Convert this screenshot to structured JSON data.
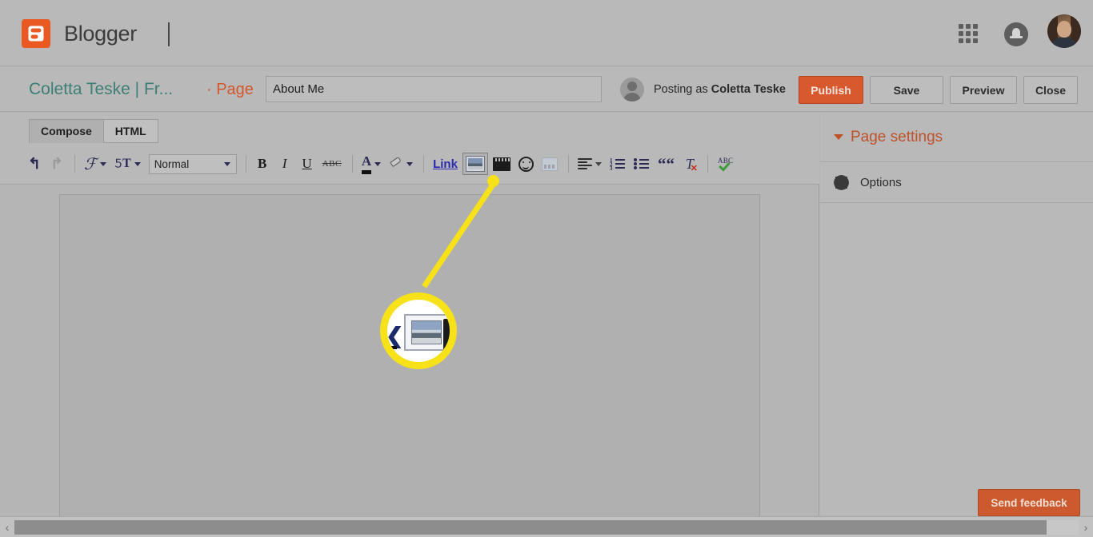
{
  "topbar": {
    "brand_name": "Blogger",
    "brand_logo_icon": "blogger-logo-icon",
    "apps_icon": "apps-grid-icon",
    "notifications_icon": "bell-icon",
    "avatar_icon": "user-avatar"
  },
  "titlerow": {
    "blog_name": "Coletta Teske  |  Fr...",
    "page_label": "· Page",
    "title_value": "About Me",
    "title_placeholder": "Page title",
    "posting_as_prefix": "Posting as ",
    "posting_as_user": "Coletta Teske",
    "buttons": {
      "publish": "Publish",
      "save": "Save",
      "preview": "Preview",
      "close": "Close"
    }
  },
  "editor": {
    "tabs": [
      {
        "label": "Compose",
        "active": true
      },
      {
        "label": "HTML",
        "active": false
      }
    ],
    "format_select_value": "Normal",
    "toolbar": [
      {
        "name": "undo-icon",
        "glyph": "↶",
        "label": "Undo"
      },
      {
        "name": "redo-icon",
        "glyph": "↷",
        "label": "Redo"
      },
      {
        "name": "font-family-icon",
        "glyph": "ℱ",
        "label": "Font"
      },
      {
        "name": "font-size-icon",
        "glyph": "TT",
        "label": "Font size"
      },
      {
        "name": "bold-icon",
        "glyph": "B",
        "label": "Bold"
      },
      {
        "name": "italic-icon",
        "glyph": "I",
        "label": "Italic"
      },
      {
        "name": "underline-icon",
        "glyph": "U",
        "label": "Underline"
      },
      {
        "name": "strikethrough-icon",
        "glyph": "ABC",
        "label": "Strikethrough"
      },
      {
        "name": "text-color-icon",
        "glyph": "A",
        "label": "Text color"
      },
      {
        "name": "highlight-icon",
        "glyph": "pen",
        "label": "Text background color"
      },
      {
        "name": "link-button",
        "glyph": "Link",
        "label": "Link"
      },
      {
        "name": "insert-image-icon",
        "glyph": "image",
        "label": "Insert image"
      },
      {
        "name": "insert-video-icon",
        "glyph": "film",
        "label": "Insert video"
      },
      {
        "name": "insert-emoji-icon",
        "glyph": "smiley",
        "label": "Insert special characters"
      },
      {
        "name": "jump-break-icon",
        "glyph": "jump",
        "label": "Insert jump break"
      },
      {
        "name": "alignment-icon",
        "glyph": "align",
        "label": "Alignment"
      },
      {
        "name": "numbered-list-icon",
        "glyph": "numlist",
        "label": "Numbered list"
      },
      {
        "name": "bulleted-list-icon",
        "glyph": "bullist",
        "label": "Bulleted list"
      },
      {
        "name": "blockquote-icon",
        "glyph": "“",
        "label": "Quote"
      },
      {
        "name": "remove-formatting-icon",
        "glyph": "Tx",
        "label": "Remove formatting"
      },
      {
        "name": "spellcheck-icon",
        "glyph": "ABC-check",
        "label": "Check spelling"
      }
    ],
    "link_label": "Link",
    "strikethrough_label": "ABC",
    "spellcheck_label": "ABC"
  },
  "sidebar": {
    "header_title": "Page settings",
    "collapse_icon": "chevron-down-icon",
    "items": [
      {
        "label": "Options",
        "icon": "gear-icon"
      }
    ]
  },
  "footer": {
    "send_feedback_label": "Send feedback",
    "scroll_left_icon": "‹",
    "scroll_right_icon": "›"
  },
  "annotation": {
    "callout_target": "insert-image-icon",
    "highlight_color": "#f7e119"
  }
}
